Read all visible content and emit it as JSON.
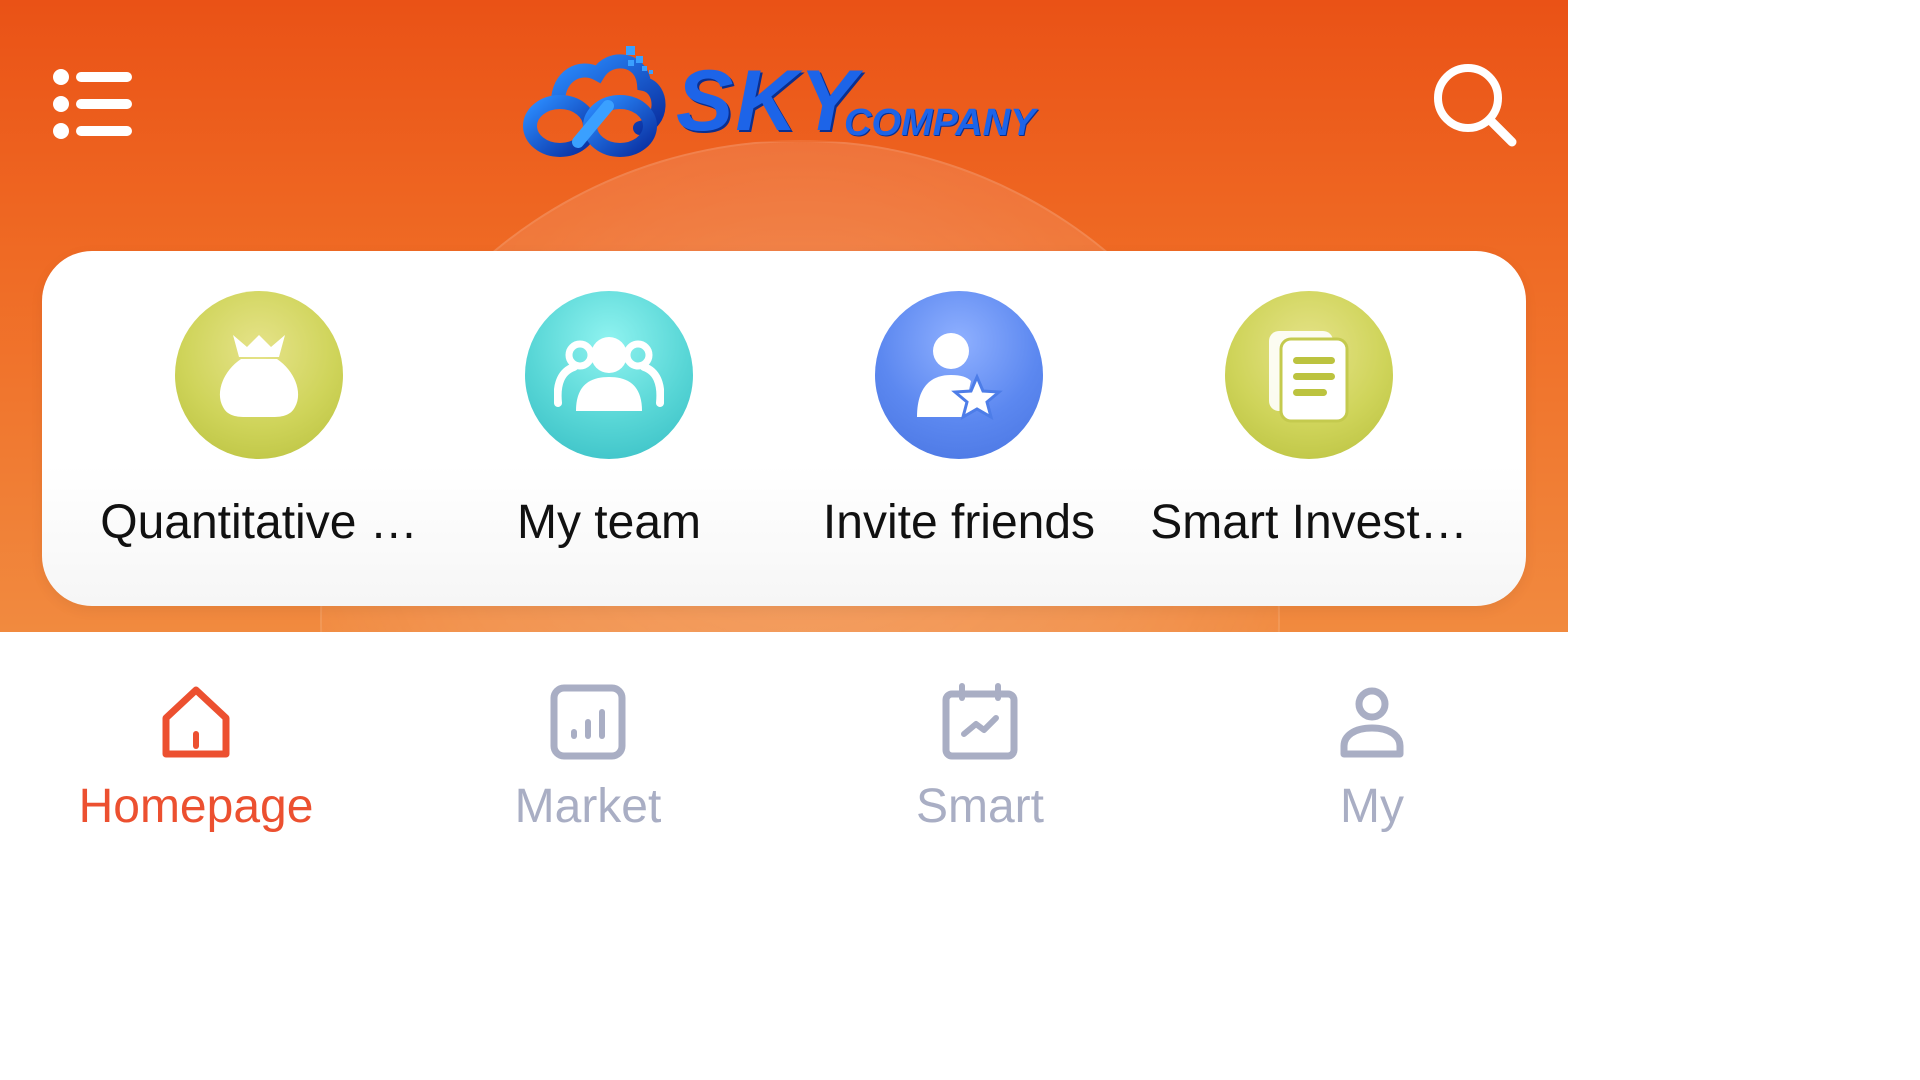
{
  "header": {
    "logo_text_main": "SKY",
    "logo_text_sub": "COMPANY",
    "menu_icon": "list-menu-icon",
    "search_icon": "search-icon"
  },
  "shortcuts": [
    {
      "label": "Quantitative …",
      "icon": "money-bag-icon",
      "color": "#c9cf52"
    },
    {
      "label": "My team",
      "icon": "team-icon",
      "color": "#4fd0d2"
    },
    {
      "label": "Invite friends",
      "icon": "user-star-icon",
      "color": "#5a85ee"
    },
    {
      "label": "Smart Invest…",
      "icon": "documents-icon",
      "color": "#c9cf52"
    }
  ],
  "tabs": [
    {
      "label": "Homepage",
      "icon": "home-icon",
      "active": true
    },
    {
      "label": "Market",
      "icon": "bar-chart-icon",
      "active": false
    },
    {
      "label": "Smart",
      "icon": "calendar-trend-icon",
      "active": false
    },
    {
      "label": "My",
      "icon": "person-icon",
      "active": false
    }
  ],
  "colors": {
    "header_top": "#ea5216",
    "header_bottom": "#f18a3f",
    "tab_active": "#ec5030",
    "tab_inactive": "#a9aec4",
    "logo_blue": "#1d64e8"
  }
}
